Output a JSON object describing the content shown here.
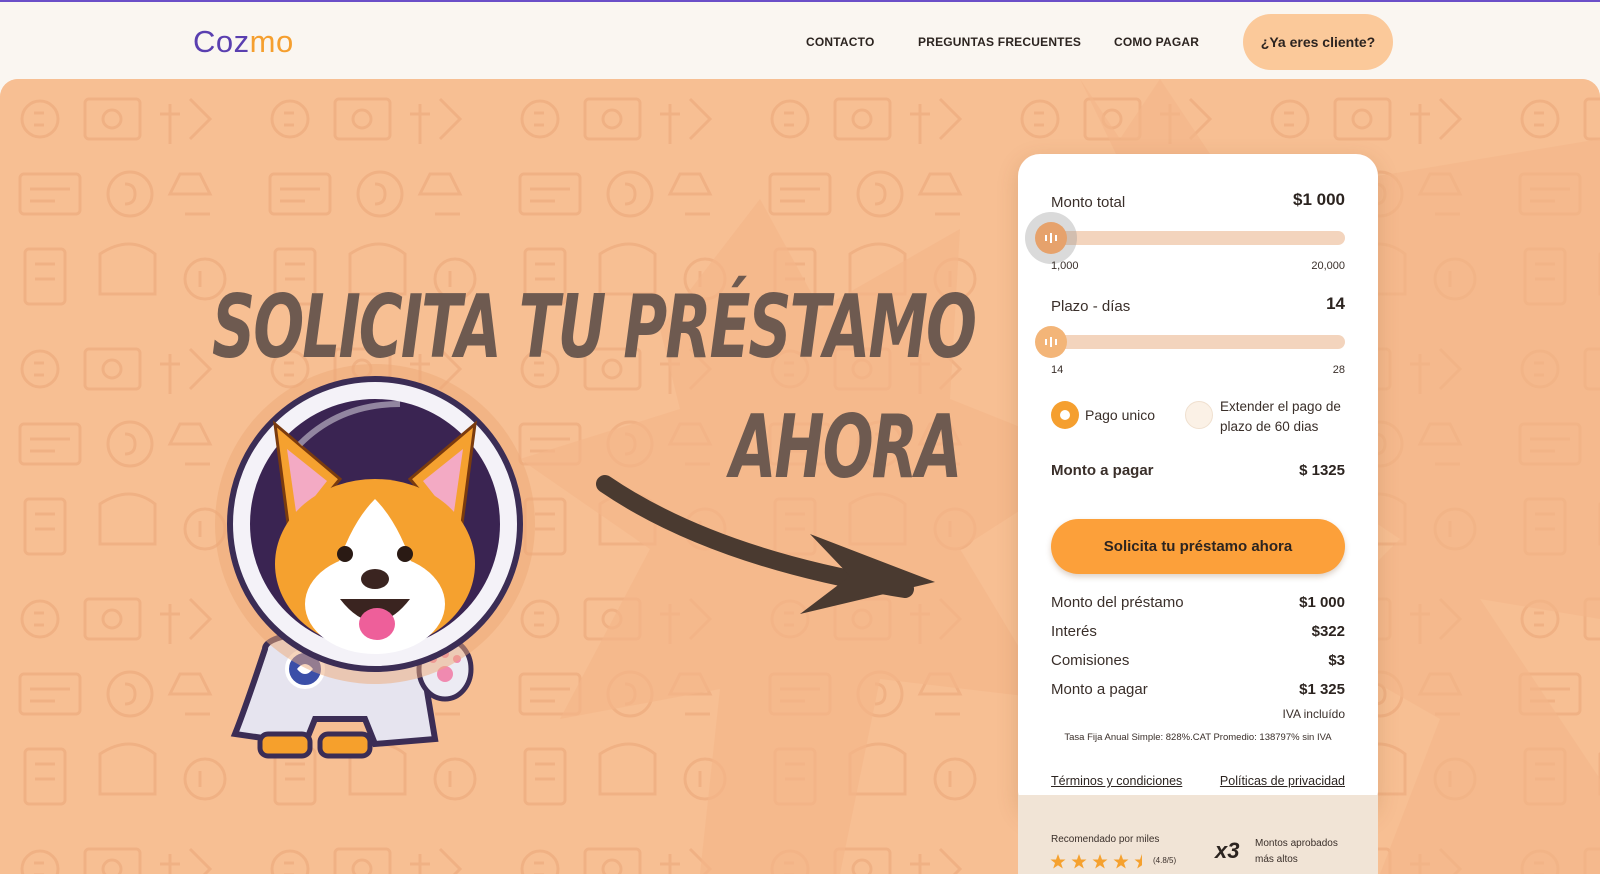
{
  "brand": {
    "logo_part1": "Coz",
    "logo_part2": "mo"
  },
  "nav": {
    "contact": "CONTACTO",
    "faq": "PREGUNTAS FRECUENTES",
    "how_to_pay": "COMO PAGAR",
    "client_button": "¿Ya eres cliente?"
  },
  "hero": {
    "headline_line1": "SOLICITA TU PRÉSTAMO",
    "headline_line2": "AHORA"
  },
  "calculator": {
    "amount": {
      "label": "Monto total",
      "value": "$1 000",
      "min_label": "1,000",
      "max_label": "20,000",
      "min": 1000,
      "max": 20000,
      "current": 1000
    },
    "term": {
      "label": "Plazo - días",
      "value": "14",
      "min_label": "14",
      "max_label": "28",
      "min": 14,
      "max": 28,
      "current": 14
    },
    "payment_options": [
      {
        "label": "Pago unico",
        "selected": true
      },
      {
        "label": "Extender el pago de plazo de 60 dias",
        "selected": false
      }
    ],
    "to_pay": {
      "label": "Monto a pagar",
      "value": "$ 1325"
    },
    "cta_label": "Solicita tu préstamo ahora",
    "breakdown": [
      {
        "label": "Monto del préstamo",
        "value": "$1 000"
      },
      {
        "label": "Interés",
        "value": "$322"
      },
      {
        "label": "Comisiones",
        "value": "$3"
      },
      {
        "label": "Monto a pagar",
        "value": "$1 325"
      }
    ],
    "iva_note": "IVA incluído",
    "rate_note": "Tasa Fija Anual Simple: 828%.CAT Promedio: 138797% sin IVA",
    "terms_link": "Términos y condiciones",
    "privacy_link": "Políticas de privacidad"
  },
  "footer_card": {
    "recommended": "Recomendado por miles",
    "rating": "(4.8/5)",
    "rating_value": 4.8,
    "multiplier": "x3",
    "approved_note": "Montos aprobados más altos"
  },
  "colors": {
    "accent": "#f59f2f",
    "brand_purple": "#5a3fb0",
    "hero_bg": "#f7bf93"
  }
}
